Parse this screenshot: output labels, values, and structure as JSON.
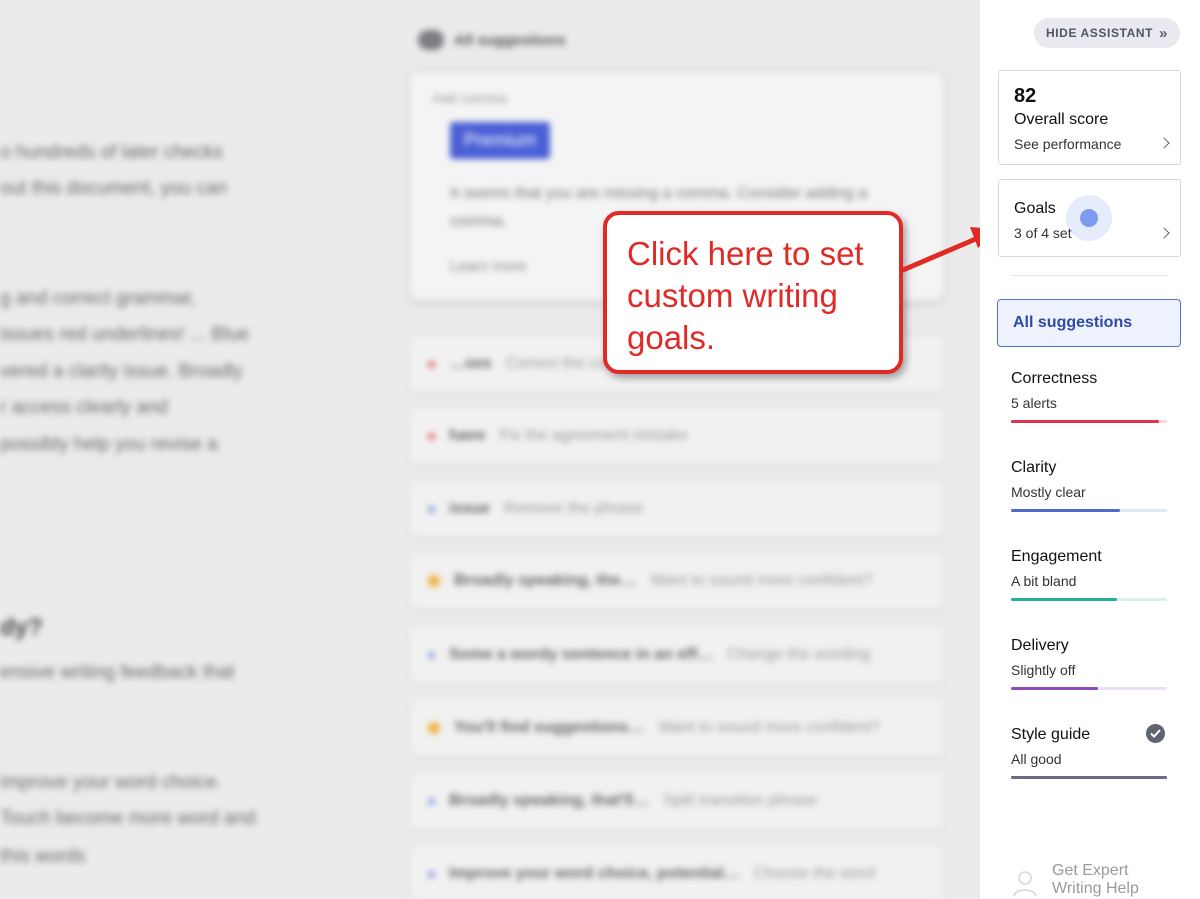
{
  "background": {
    "document_lines": [
      "o hundreds of later checks",
      "out this document, you can",
      "g and correct grammar,",
      "issues red underlines! ... Blue",
      "vered a clarity issue. Broadly",
      "r access clearly and",
      "possibly help you revise a",
      "dy?",
      "ensive writing feedback that",
      "improve your word choice.",
      "Touch become more word and",
      "this words"
    ],
    "suggestions_header": "All suggestions",
    "top_card": {
      "type": "Add comma",
      "chip": "Premium",
      "description": "It seems that you are missing a comma. Consider adding a comma.",
      "learn_more": "Learn more"
    },
    "rows": [
      {
        "main": "…ses",
        "sub": "Correct the correct",
        "dot": "red"
      },
      {
        "main": "have",
        "sub": "Fix the agreement mistake",
        "dot": "red"
      },
      {
        "main": "issue",
        "sub": "Remove the phrase",
        "dot": "blue"
      },
      {
        "main": "Broadly speaking, the…",
        "sub": "Want to sound more confident?",
        "dot": "yellow"
      },
      {
        "main": "Some a wordy sentence in an eff…",
        "sub": "Change the wording",
        "dot": "blue"
      },
      {
        "main": "You'll find suggestions…",
        "sub": "Want to sound more confident?",
        "dot": "yellow"
      },
      {
        "main": "Broadly speaking, that'll…",
        "sub": "Split transition phrase",
        "dot": "blue"
      },
      {
        "main": "Improve your word choice, potential…",
        "sub": "Choose the word",
        "dot": "blue"
      }
    ]
  },
  "callout": {
    "text": "Click here to set custom writing goals."
  },
  "assistant": {
    "hide_label": "HIDE ASSISTANT",
    "hide_icon": "double-chevron-right",
    "score": {
      "value": "82",
      "label": "Overall score",
      "link": "See performance"
    },
    "goals": {
      "title": "Goals",
      "status": "3 of 4 set"
    },
    "all_suggestions": "All suggestions",
    "categories": [
      {
        "name": "Correctness",
        "status": "5 alerts",
        "color": "#e0324b",
        "track": "#f6d6dc",
        "fill": 0.95
      },
      {
        "name": "Clarity",
        "status": "Mostly clear",
        "color": "#4d6bc7",
        "track": "#dfe6f8",
        "fill": 0.7
      },
      {
        "name": "Engagement",
        "status": "A bit bland",
        "color": "#21b38a",
        "track": "#d4f2e8",
        "fill": 0.68
      },
      {
        "name": "Delivery",
        "status": "Slightly off",
        "color": "#8a4ab8",
        "track": "#ece0f3",
        "fill": 0.56
      },
      {
        "name": "Style guide",
        "status": "All good",
        "color": "#6b6a86",
        "track": "#6b6a86",
        "fill": 1.0,
        "check": true
      }
    ],
    "expert": {
      "label": "Get Expert Writing Help"
    }
  },
  "colors": {
    "callout_red": "#e12a26",
    "accent_blue": "#2f4aa8"
  }
}
